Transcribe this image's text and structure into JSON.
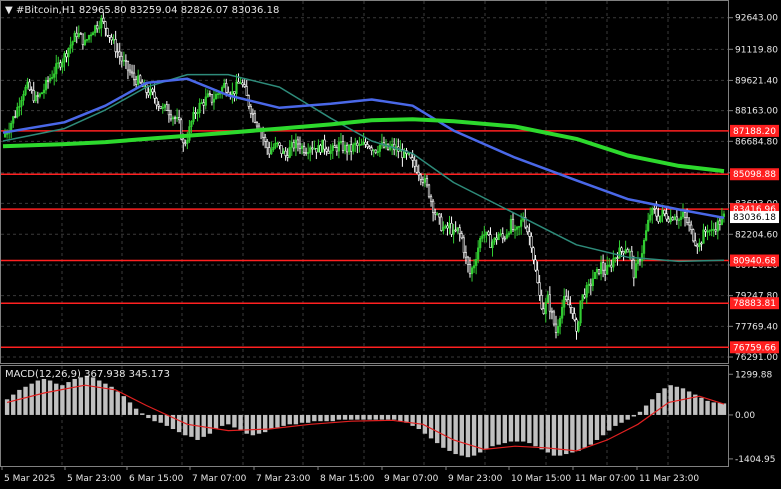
{
  "header": {
    "symbol_title": "#Bitcoin,H1  82965.80 83259.04 82826.07 83036.18"
  },
  "price_axis": {
    "ticks": [
      "92643.00",
      "91119.80",
      "89621.40",
      "88163.00",
      "86684.80",
      "85166.60",
      "83693.00",
      "82204.60",
      "80726.20",
      "79247.80",
      "77769.40",
      "76291.00"
    ],
    "current_price_label": "83036.18"
  },
  "horizontal_levels": [
    {
      "label": "87188.20",
      "price": 87188.2
    },
    {
      "label": "85098.88",
      "price": 85098.88
    },
    {
      "label": "83416.96",
      "price": 83416.96
    },
    {
      "label": "80940.68",
      "price": 80940.68
    },
    {
      "label": "78883.81",
      "price": 78883.81
    },
    {
      "label": "76759.66",
      "price": 76759.66
    }
  ],
  "macd": {
    "title": "MACD(12,26,9) 367.938 345.173",
    "ticks": [
      "1299.88",
      "0.00",
      "-1404.95"
    ]
  },
  "time_axis": {
    "labels": [
      "5 Mar 2025",
      "5 Mar 23:00",
      "6 Mar 15:00",
      "7 Mar 07:00",
      "7 Mar 23:00",
      "8 Mar 15:00",
      "9 Mar 07:00",
      "9 Mar 23:00",
      "10 Mar 15:00",
      "11 Mar 07:00",
      "11 Mar 23:00"
    ]
  },
  "colors": {
    "background": "#000000",
    "bull_candle": "#32cd32",
    "bear_candle": "#ffffff",
    "level_line": "#ff2020",
    "ma_fast": "#4a68e8",
    "ma_mid": "#2e8b7a",
    "ma_slow": "#2dd92d",
    "macd_signal": "#e02020",
    "macd_hist": "#c0c0c0"
  },
  "chart_data": {
    "type": "candlestick",
    "y_range": [
      76050,
      93400
    ],
    "close_path": [
      [
        0,
        86900
      ],
      [
        4,
        87200
      ],
      [
        8,
        87600
      ],
      [
        12,
        88000
      ],
      [
        16,
        88600
      ],
      [
        20,
        89100
      ],
      [
        24,
        89300
      ],
      [
        28,
        89000
      ],
      [
        32,
        88700
      ],
      [
        36,
        88900
      ],
      [
        40,
        89200
      ],
      [
        44,
        89600
      ],
      [
        48,
        89900
      ],
      [
        52,
        90200
      ],
      [
        56,
        90500
      ],
      [
        60,
        90800
      ],
      [
        64,
        91200
      ],
      [
        68,
        91500
      ],
      [
        72,
        91900
      ],
      [
        76,
        91700
      ],
      [
        80,
        91400
      ],
      [
        84,
        91800
      ],
      [
        88,
        92100
      ],
      [
        92,
        92300
      ],
      [
        96,
        92500
      ],
      [
        100,
        92200
      ],
      [
        104,
        91800
      ],
      [
        108,
        91400
      ],
      [
        112,
        91000
      ],
      [
        116,
        90600
      ],
      [
        120,
        90300
      ],
      [
        124,
        90000
      ],
      [
        128,
        89700
      ],
      [
        132,
        89600
      ],
      [
        136,
        89300
      ],
      [
        140,
        89100
      ],
      [
        144,
        89000
      ],
      [
        148,
        88800
      ],
      [
        152,
        88500
      ],
      [
        156,
        88200
      ],
      [
        160,
        88300
      ],
      [
        164,
        88000
      ],
      [
        168,
        87800
      ],
      [
        172,
        87500
      ],
      [
        176,
        86500
      ],
      [
        180,
        86900
      ],
      [
        184,
        87600
      ],
      [
        188,
        88100
      ],
      [
        192,
        88400
      ],
      [
        196,
        88600
      ],
      [
        200,
        88800
      ],
      [
        204,
        88700
      ],
      [
        208,
        88900
      ],
      [
        212,
        89100
      ],
      [
        216,
        89400
      ],
      [
        220,
        89200
      ],
      [
        224,
        89000
      ],
      [
        228,
        89300
      ],
      [
        232,
        89600
      ],
      [
        236,
        89100
      ],
      [
        240,
        88500
      ],
      [
        244,
        88000
      ],
      [
        248,
        87600
      ],
      [
        252,
        87200
      ],
      [
        256,
        86600
      ],
      [
        260,
        86200
      ],
      [
        264,
        86400
      ],
      [
        268,
        86500
      ],
      [
        272,
        86200
      ],
      [
        276,
        86000
      ],
      [
        280,
        86300
      ],
      [
        284,
        86500
      ],
      [
        288,
        86600
      ],
      [
        292,
        86400
      ],
      [
        296,
        86300
      ],
      [
        300,
        86500
      ],
      [
        304,
        86400
      ],
      [
        308,
        86300
      ],
      [
        312,
        86500
      ],
      [
        316,
        86400
      ],
      [
        320,
        86200
      ],
      [
        324,
        86300
      ],
      [
        328,
        86500
      ],
      [
        332,
        86400
      ],
      [
        336,
        86300
      ],
      [
        340,
        86300
      ],
      [
        344,
        86500
      ],
      [
        348,
        86400
      ],
      [
        352,
        86500
      ],
      [
        356,
        86600
      ],
      [
        360,
        86400
      ],
      [
        364,
        86300
      ],
      [
        368,
        86500
      ],
      [
        372,
        86400
      ],
      [
        376,
        86300
      ],
      [
        380,
        86400
      ],
      [
        384,
        86300
      ],
      [
        388,
        86200
      ],
      [
        392,
        86000
      ],
      [
        396,
        85900
      ],
      [
        400,
        85600
      ],
      [
        404,
        85400
      ],
      [
        408,
        85100
      ],
      [
        412,
        84700
      ],
      [
        416,
        84200
      ],
      [
        420,
        83500
      ],
      [
        424,
        83000
      ],
      [
        428,
        82600
      ],
      [
        432,
        82400
      ],
      [
        436,
        82600
      ],
      [
        440,
        82200
      ],
      [
        444,
        82400
      ],
      [
        448,
        82000
      ],
      [
        452,
        81000
      ],
      [
        456,
        80300
      ],
      [
        460,
        80800
      ],
      [
        464,
        81600
      ],
      [
        468,
        82300
      ],
      [
        472,
        82100
      ],
      [
        476,
        81800
      ],
      [
        480,
        81900
      ],
      [
        484,
        82200
      ],
      [
        488,
        82000
      ],
      [
        492,
        82300
      ],
      [
        496,
        82700
      ],
      [
        500,
        82200
      ],
      [
        504,
        82500
      ],
      [
        508,
        83100
      ],
      [
        512,
        82400
      ],
      [
        516,
        81800
      ],
      [
        520,
        80400
      ],
      [
        524,
        79200
      ],
      [
        528,
        78500
      ],
      [
        532,
        79100
      ],
      [
        536,
        78300
      ],
      [
        540,
        77500
      ],
      [
        544,
        78400
      ],
      [
        548,
        79000
      ],
      [
        552,
        78800
      ],
      [
        556,
        78600
      ],
      [
        560,
        77300
      ],
      [
        564,
        79000
      ],
      [
        568,
        79400
      ],
      [
        572,
        79600
      ],
      [
        576,
        80100
      ],
      [
        580,
        80300
      ],
      [
        584,
        80700
      ],
      [
        588,
        80400
      ],
      [
        592,
        80600
      ],
      [
        596,
        81000
      ],
      [
        600,
        81300
      ],
      [
        604,
        81400
      ],
      [
        608,
        81600
      ],
      [
        612,
        81300
      ],
      [
        616,
        80300
      ],
      [
        620,
        80800
      ],
      [
        624,
        81400
      ],
      [
        628,
        82300
      ],
      [
        632,
        83200
      ],
      [
        636,
        83300
      ],
      [
        640,
        83000
      ],
      [
        644,
        83200
      ],
      [
        648,
        83100
      ],
      [
        652,
        83000
      ],
      [
        656,
        83200
      ],
      [
        660,
        82900
      ],
      [
        664,
        83100
      ],
      [
        668,
        82800
      ],
      [
        672,
        82300
      ],
      [
        676,
        81900
      ],
      [
        680,
        81700
      ],
      [
        684,
        82200
      ],
      [
        688,
        82500
      ],
      [
        692,
        82300
      ],
      [
        696,
        82600
      ],
      [
        700,
        82800
      ],
      [
        704,
        83036
      ]
    ],
    "ma_fast": [
      [
        0,
        87100
      ],
      [
        60,
        87600
      ],
      [
        100,
        88400
      ],
      [
        140,
        89500
      ],
      [
        180,
        89700
      ],
      [
        220,
        88900
      ],
      [
        270,
        88300
      ],
      [
        320,
        88500
      ],
      [
        360,
        88700
      ],
      [
        400,
        88400
      ],
      [
        440,
        87200
      ],
      [
        500,
        85900
      ],
      [
        560,
        84800
      ],
      [
        610,
        83900
      ],
      [
        660,
        83400
      ],
      [
        704,
        83000
      ]
    ],
    "ma_mid": [
      [
        0,
        86700
      ],
      [
        60,
        87300
      ],
      [
        100,
        88200
      ],
      [
        140,
        89300
      ],
      [
        180,
        89900
      ],
      [
        220,
        89900
      ],
      [
        270,
        89300
      ],
      [
        320,
        87800
      ],
      [
        360,
        86700
      ],
      [
        400,
        86100
      ],
      [
        440,
        84700
      ],
      [
        500,
        83200
      ],
      [
        560,
        81700
      ],
      [
        610,
        81100
      ],
      [
        660,
        80900
      ],
      [
        704,
        80950
      ]
    ],
    "ma_slow": [
      [
        0,
        86450
      ],
      [
        60,
        86550
      ],
      [
        100,
        86650
      ],
      [
        140,
        86800
      ],
      [
        180,
        86950
      ],
      [
        220,
        87100
      ],
      [
        270,
        87300
      ],
      [
        320,
        87500
      ],
      [
        360,
        87700
      ],
      [
        400,
        87750
      ],
      [
        440,
        87650
      ],
      [
        500,
        87400
      ],
      [
        560,
        86800
      ],
      [
        610,
        86000
      ],
      [
        660,
        85500
      ],
      [
        704,
        85250
      ]
    ],
    "macd_hist": [
      [
        4,
        500
      ],
      [
        10,
        650
      ],
      [
        16,
        800
      ],
      [
        22,
        900
      ],
      [
        28,
        1000
      ],
      [
        34,
        1100
      ],
      [
        40,
        1150
      ],
      [
        46,
        1100
      ],
      [
        52,
        1000
      ],
      [
        58,
        950
      ],
      [
        64,
        1050
      ],
      [
        70,
        1150
      ],
      [
        76,
        1200
      ],
      [
        82,
        1250
      ],
      [
        88,
        1200
      ],
      [
        94,
        1100
      ],
      [
        100,
        1000
      ],
      [
        106,
        900
      ],
      [
        112,
        750
      ],
      [
        118,
        600
      ],
      [
        124,
        400
      ],
      [
        130,
        200
      ],
      [
        136,
        50
      ],
      [
        142,
        -100
      ],
      [
        148,
        -200
      ],
      [
        154,
        -250
      ],
      [
        160,
        -350
      ],
      [
        166,
        -450
      ],
      [
        172,
        -550
      ],
      [
        178,
        -650
      ],
      [
        184,
        -700
      ],
      [
        190,
        -800
      ],
      [
        196,
        -700
      ],
      [
        202,
        -600
      ],
      [
        208,
        -450
      ],
      [
        214,
        -350
      ],
      [
        220,
        -300
      ],
      [
        226,
        -400
      ],
      [
        232,
        -500
      ],
      [
        238,
        -600
      ],
      [
        244,
        -650
      ],
      [
        250,
        -600
      ],
      [
        256,
        -550
      ],
      [
        262,
        -450
      ],
      [
        268,
        -400
      ],
      [
        274,
        -350
      ],
      [
        280,
        -300
      ],
      [
        286,
        -300
      ],
      [
        292,
        -250
      ],
      [
        298,
        -250
      ],
      [
        304,
        -200
      ],
      [
        310,
        -200
      ],
      [
        316,
        -200
      ],
      [
        322,
        -200
      ],
      [
        328,
        -150
      ],
      [
        334,
        -150
      ],
      [
        340,
        -150
      ],
      [
        346,
        -150
      ],
      [
        352,
        -150
      ],
      [
        358,
        -150
      ],
      [
        364,
        -150
      ],
      [
        370,
        -150
      ],
      [
        376,
        -150
      ],
      [
        382,
        -150
      ],
      [
        388,
        -200
      ],
      [
        394,
        -250
      ],
      [
        400,
        -350
      ],
      [
        406,
        -450
      ],
      [
        412,
        -600
      ],
      [
        418,
        -750
      ],
      [
        424,
        -900
      ],
      [
        430,
        -1050
      ],
      [
        436,
        -1150
      ],
      [
        442,
        -1250
      ],
      [
        448,
        -1300
      ],
      [
        454,
        -1350
      ],
      [
        460,
        -1300
      ],
      [
        466,
        -1200
      ],
      [
        472,
        -1100
      ],
      [
        478,
        -1000
      ],
      [
        484,
        -950
      ],
      [
        490,
        -900
      ],
      [
        496,
        -850
      ],
      [
        502,
        -850
      ],
      [
        508,
        -850
      ],
      [
        514,
        -900
      ],
      [
        520,
        -1000
      ],
      [
        526,
        -1100
      ],
      [
        532,
        -1200
      ],
      [
        538,
        -1300
      ],
      [
        544,
        -1300
      ],
      [
        550,
        -1250
      ],
      [
        556,
        -1200
      ],
      [
        562,
        -1150
      ],
      [
        568,
        -1050
      ],
      [
        574,
        -950
      ],
      [
        580,
        -800
      ],
      [
        586,
        -650
      ],
      [
        592,
        -500
      ],
      [
        598,
        -350
      ],
      [
        604,
        -250
      ],
      [
        610,
        -150
      ],
      [
        616,
        -50
      ],
      [
        622,
        100
      ],
      [
        628,
        300
      ],
      [
        634,
        500
      ],
      [
        640,
        700
      ],
      [
        646,
        850
      ],
      [
        652,
        950
      ],
      [
        658,
        900
      ],
      [
        664,
        850
      ],
      [
        670,
        750
      ],
      [
        676,
        650
      ],
      [
        682,
        550
      ],
      [
        688,
        450
      ],
      [
        694,
        400
      ],
      [
        700,
        380
      ],
      [
        704,
        368
      ]
    ],
    "macd_signal": [
      [
        4,
        400
      ],
      [
        40,
        700
      ],
      [
        80,
        950
      ],
      [
        110,
        800
      ],
      [
        140,
        300
      ],
      [
        180,
        -300
      ],
      [
        220,
        -500
      ],
      [
        260,
        -450
      ],
      [
        300,
        -300
      ],
      [
        340,
        -200
      ],
      [
        380,
        -170
      ],
      [
        410,
        -300
      ],
      [
        440,
        -800
      ],
      [
        470,
        -1100
      ],
      [
        500,
        -1000
      ],
      [
        530,
        -1050
      ],
      [
        560,
        -1150
      ],
      [
        590,
        -800
      ],
      [
        620,
        -300
      ],
      [
        650,
        400
      ],
      [
        680,
        600
      ],
      [
        704,
        345
      ]
    ]
  }
}
